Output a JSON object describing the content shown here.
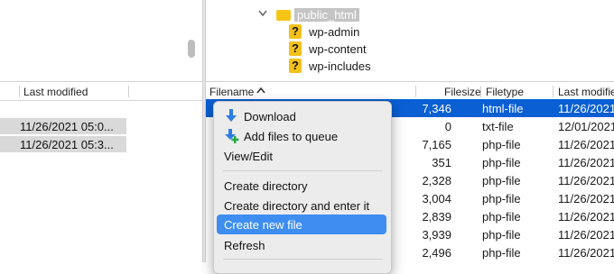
{
  "tree": {
    "current_folder": "public_html",
    "children": [
      "wp-admin",
      "wp-content",
      "wp-includes"
    ]
  },
  "local_pane": {
    "header": {
      "last_modified": "Last modified"
    },
    "rows": [
      {
        "last_modified": "11/26/2021 05:0..."
      },
      {
        "last_modified": "11/26/2021 05:3..."
      }
    ]
  },
  "remote_pane": {
    "header": {
      "filename": "Filename",
      "filesize": "Filesize",
      "filetype": "Filetype",
      "last_modified": "Last modifie"
    },
    "rows": [
      {
        "size": "7,346",
        "type": "html-file",
        "modified": "11/26/2021"
      },
      {
        "size": "0",
        "type": "txt-file",
        "modified": "12/01/2021"
      },
      {
        "size": "7,165",
        "type": "php-file",
        "modified": "11/26/2021"
      },
      {
        "size": "351",
        "type": "php-file",
        "modified": "11/26/2021"
      },
      {
        "size": "2,328",
        "type": "php-file",
        "modified": "11/26/2021"
      },
      {
        "size": "3,004",
        "type": "php-file",
        "modified": "11/26/2021"
      },
      {
        "size": "2,839",
        "type": "php-file",
        "modified": "11/26/2021"
      },
      {
        "size": "3,939",
        "type": "php-file",
        "modified": "11/26/2021"
      },
      {
        "size": "2,496",
        "type": "php-file",
        "modified": "11/26/2021"
      }
    ]
  },
  "context_menu": {
    "items": [
      {
        "label": "Download"
      },
      {
        "label": "Add files to queue"
      },
      {
        "label": "View/Edit"
      },
      {
        "label": "Create directory"
      },
      {
        "label": "Create directory and enter it"
      },
      {
        "label": "Create new file"
      },
      {
        "label": "Refresh"
      }
    ],
    "highlighted": "Create new file"
  },
  "colors": {
    "selection": "#0a5fd3",
    "menu_highlight": "#3d8ef0",
    "folder": "#f5c518"
  }
}
